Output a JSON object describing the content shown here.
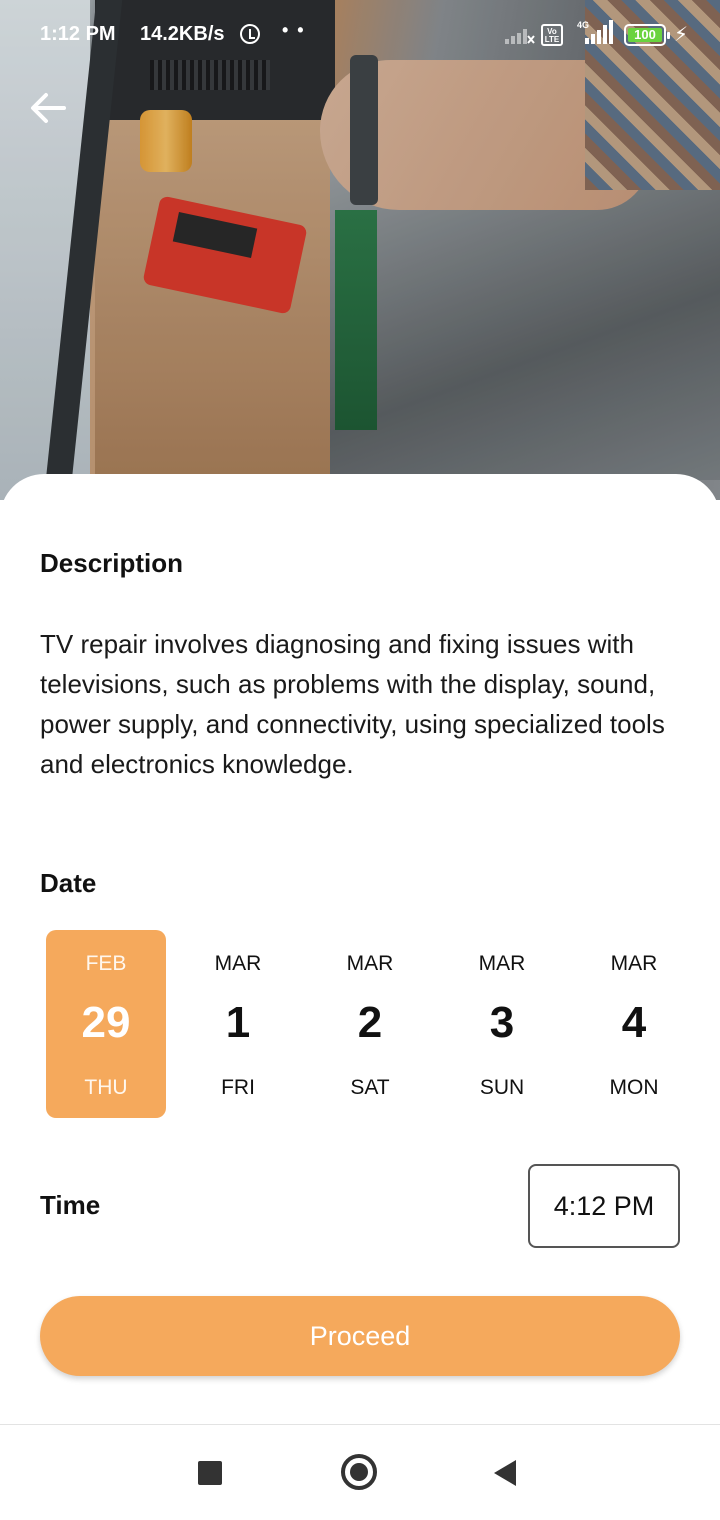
{
  "status_bar": {
    "time": "1:12 PM",
    "speed": "14.2KB/s",
    "dots": "• •",
    "volte": "Vo LTE",
    "network": "4G",
    "battery": "100",
    "icons": [
      "alarm-icon",
      "signal-icon",
      "volte-icon",
      "battery-icon",
      "charging-icon"
    ]
  },
  "hero": {
    "image": "tv-repair-photo",
    "back_icon": "arrow-left-icon"
  },
  "description": {
    "title": "Description",
    "text": "TV repair involves diagnosing and fixing issues with televisions, such as problems with the display, sound, power supply, and connectivity, using specialized tools and electronics knowledge."
  },
  "date": {
    "title": "Date",
    "items": [
      {
        "month": "FEB",
        "day": "29",
        "weekday": "THU",
        "selected": true
      },
      {
        "month": "MAR",
        "day": "1",
        "weekday": "FRI",
        "selected": false
      },
      {
        "month": "MAR",
        "day": "2",
        "weekday": "SAT",
        "selected": false
      },
      {
        "month": "MAR",
        "day": "3",
        "weekday": "SUN",
        "selected": false
      },
      {
        "month": "MAR",
        "day": "4",
        "weekday": "MON",
        "selected": false
      }
    ]
  },
  "time": {
    "title": "Time",
    "value": "4:12 PM"
  },
  "proceed": {
    "label": "Proceed"
  },
  "colors": {
    "accent": "#f5a95c",
    "text": "#111111",
    "background": "#ffffff"
  },
  "navbar": {
    "icons": [
      "recents-square-icon",
      "home-circle-icon",
      "back-triangle-icon"
    ]
  }
}
